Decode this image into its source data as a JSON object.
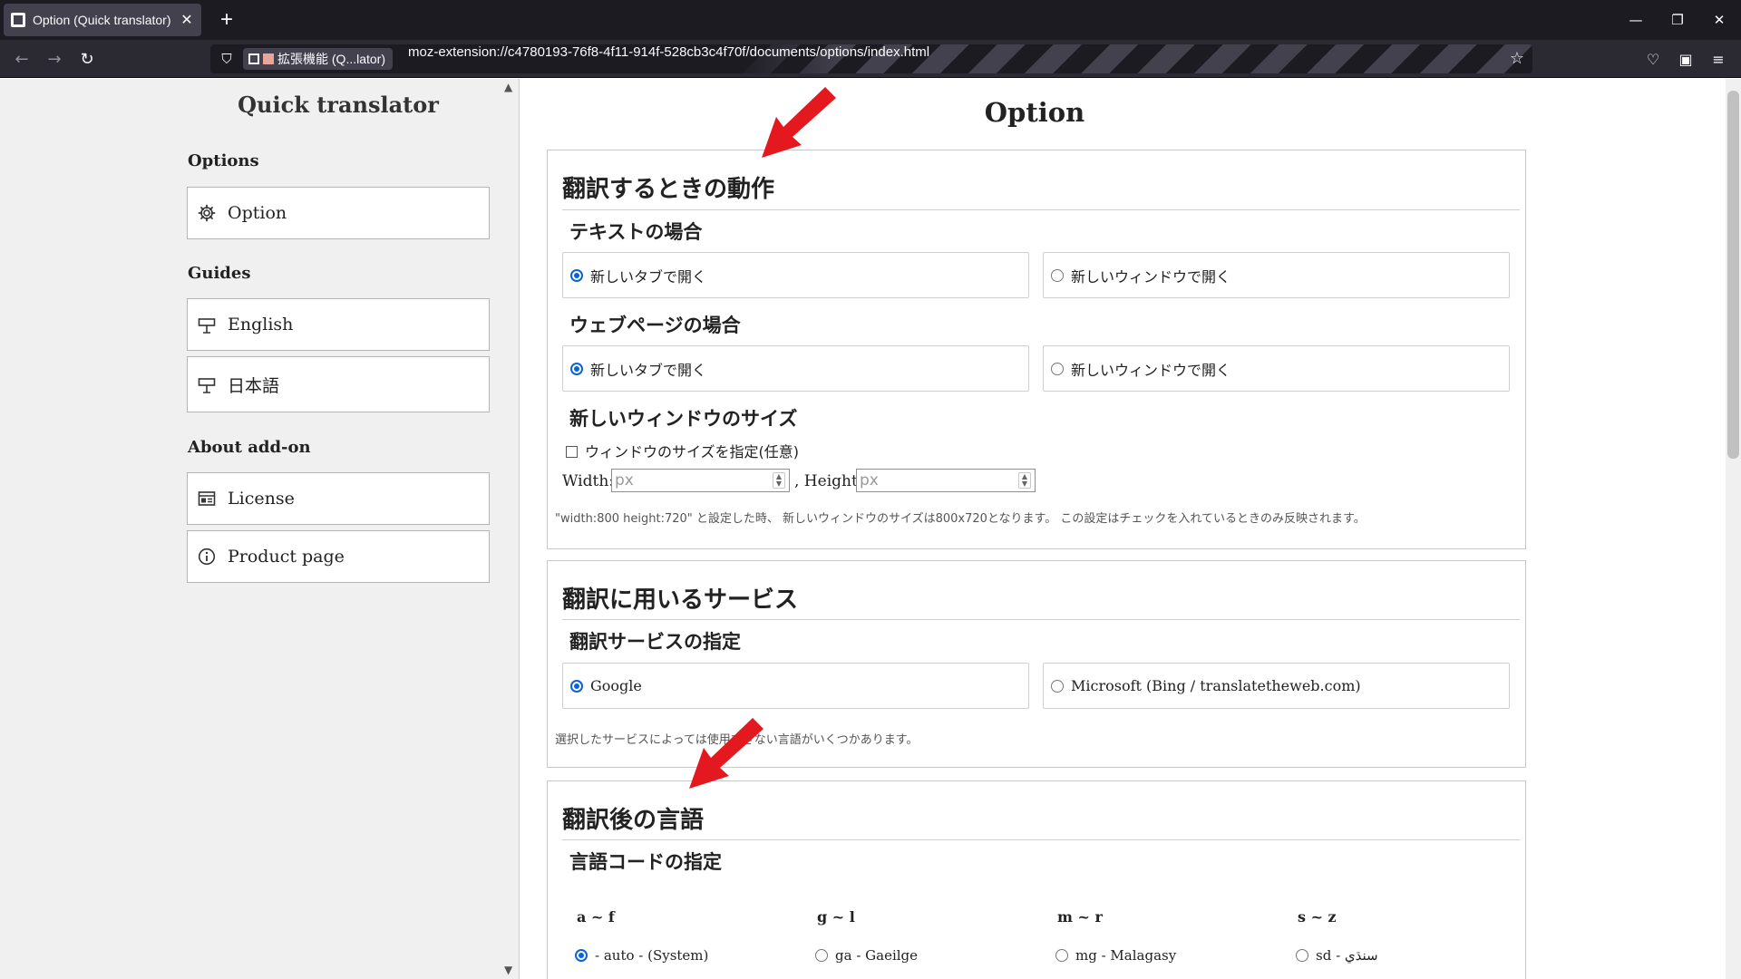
{
  "browser": {
    "tab_title": "Option (Quick translator)",
    "new_tab": "+",
    "tab_close": "✕",
    "identity_label": "拡張機能 (Q...lator)",
    "url": "moz-extension://c4780193-76f8-4f11-914f-528cb3c4f70f/documents/options/index.html"
  },
  "sidebar": {
    "title": "Quick translator",
    "sections": {
      "options": {
        "heading": "Options",
        "items": [
          {
            "label": "Option",
            "icon": "gear-icon"
          }
        ]
      },
      "guides": {
        "heading": "Guides",
        "items": [
          {
            "label": "English",
            "icon": "signpost-icon"
          },
          {
            "label": "日本語",
            "icon": "signpost-icon"
          }
        ]
      },
      "about": {
        "heading": "About add-on",
        "items": [
          {
            "label": "License",
            "icon": "license-icon"
          },
          {
            "label": "Product page",
            "icon": "info-icon"
          }
        ]
      }
    }
  },
  "main": {
    "page_title": "Option",
    "behavior": {
      "title": "翻訳するときの動作",
      "text_case": {
        "title": "テキストの場合",
        "options": [
          {
            "label": "新しいタブで開く",
            "selected": true
          },
          {
            "label": "新しいウィンドウで開く",
            "selected": false
          }
        ]
      },
      "webpage_case": {
        "title": "ウェブページの場合",
        "options": [
          {
            "label": "新しいタブで開く",
            "selected": true
          },
          {
            "label": "新しいウィンドウで開く",
            "selected": false
          }
        ]
      },
      "window_size": {
        "title": "新しいウィンドウのサイズ",
        "checkbox_label": "ウィンドウのサイズを指定(任意)",
        "checked": false,
        "width_label": "Width:",
        "width_placeholder": "px",
        "height_label": ", Height:",
        "height_placeholder": "px",
        "note": "\"width:800 height:720\" と設定した時、 新しいウィンドウのサイズは800x720となります。 この設定はチェックを入れているときのみ反映されます。"
      }
    },
    "service": {
      "title": "翻訳に用いるサービス",
      "subtitle": "翻訳サービスの指定",
      "options": [
        {
          "label": "Google",
          "selected": true
        },
        {
          "label": "Microsoft (Bing / translatetheweb.com)",
          "selected": false
        }
      ],
      "note": "選択したサービスによっては使用できない言語がいくつかあります。"
    },
    "target_language": {
      "title": "翻訳後の言語",
      "subtitle": "言語コードの指定",
      "columns": [
        {
          "heading": "a ~ f",
          "first_item": "- auto - (System)",
          "selected": true
        },
        {
          "heading": "g ~ l",
          "first_item": "ga - Gaeilge",
          "selected": false
        },
        {
          "heading": "m ~ r",
          "first_item": "mg - Malagasy",
          "selected": false
        },
        {
          "heading": "s ~ z",
          "first_item": "sd - سنڌي",
          "selected": false
        }
      ]
    }
  },
  "colors": {
    "radio_accent": "#0b63d6",
    "annotation_arrow": "#e3191f"
  }
}
